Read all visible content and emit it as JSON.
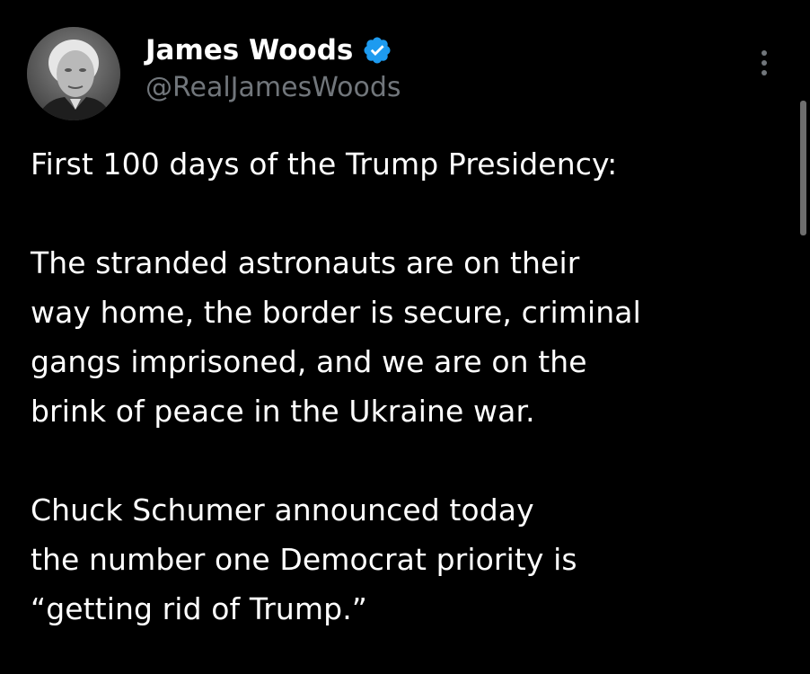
{
  "tweet": {
    "author": {
      "display_name": "James Woods",
      "handle": "@RealJamesWoods",
      "verified": true,
      "verified_color": "#1d9bf0"
    },
    "paragraphs": [
      "First 100 days of the Trump Presidency:",
      "The stranded astronauts are on their\nway home, the border is secure, criminal\ngangs imprisoned, and we are on the\nbrink of peace in the Ukraine war.",
      "Chuck Schumer announced today\nthe number one Democrat priority is\n“getting rid of Trump.”"
    ]
  },
  "icons": {
    "verified": "verified-badge-icon",
    "more": "more-options-icon"
  },
  "colors": {
    "background": "#000000",
    "text": "#ffffff",
    "secondary_text": "#71767b"
  }
}
